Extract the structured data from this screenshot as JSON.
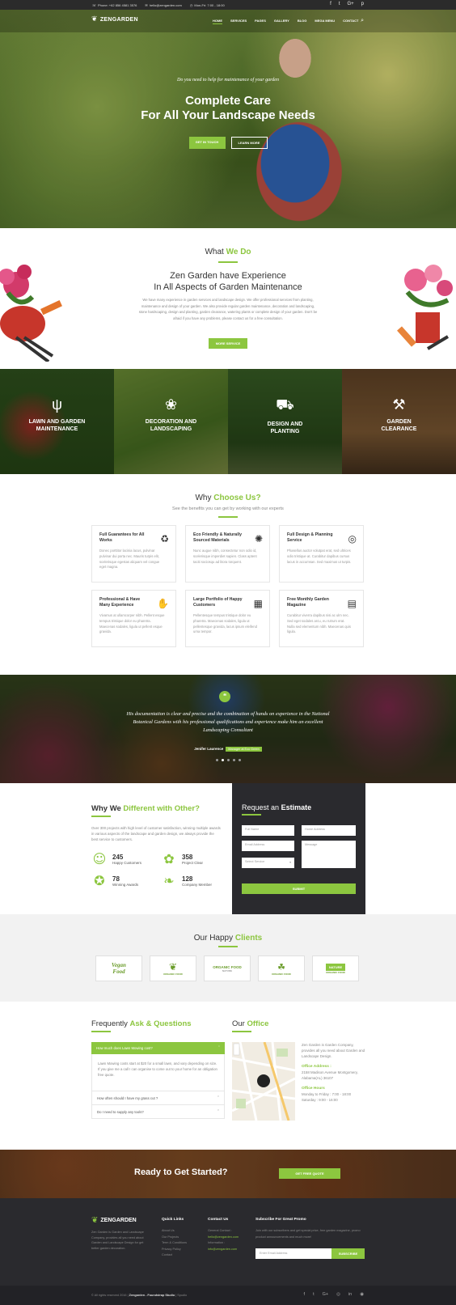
{
  "topbar": {
    "phone": "Phone: +62 856 4581 3576",
    "email": "hello@zengarden.com",
    "hours": "Mon-Fri: 7:00 - 18:00",
    "social": [
      "f",
      "t",
      "G+",
      "p"
    ]
  },
  "nav": {
    "logo": "ZENGARDEN",
    "items": [
      "HOME",
      "SERVICES",
      "PAGES",
      "GALLERY",
      "BLOG",
      "MEGA MENU",
      "CONTACT"
    ]
  },
  "hero": {
    "tagline": "Do you need to help for maintenance of your garden",
    "title_line1": "Complete Care",
    "title_line2": "For All Your Landscape Needs",
    "btn_primary": "GET IN TOUCH",
    "btn_secondary": "LEARN MORE"
  },
  "what_we_do": {
    "title_a": "What",
    "title_b": "We Do",
    "heading_line1": "Zen Garden have Experience",
    "heading_line2": "In All Aspects of Garden Maintenance",
    "text": "We have many experience in garden services and landscape design. We offer professional services from planting, maintenance and design of your garden. We also provide regular garden maintenance, decoration and landscaping, stone hardscaping, design and planting, garden clearance, watering plants or complete design of your garden. Don't be afraid if you have any problems, please contact us for a free consultation.",
    "button": "MORE SERVICE"
  },
  "services": [
    {
      "line1": "LAWN AND GARDEN",
      "line2": "MAINTENANCE",
      "icon": "grass-icon"
    },
    {
      "line1": "DECORATION AND",
      "line2": "LANDSCAPING",
      "icon": "sprout-icon"
    },
    {
      "line1": "DESIGN AND",
      "line2": "PLANTING",
      "icon": "wheelbarrow-icon"
    },
    {
      "line1": "GARDEN",
      "line2": "CLEARANCE",
      "icon": "tools-icon"
    }
  ],
  "why": {
    "title_a": "Why",
    "title_b": "Choose Us?",
    "subtitle": "See the benefits you can get by working with our experts",
    "cards": [
      {
        "title": "Full Guarantees for All Works",
        "text": "Donec porttitor lacinia lacus, pulvinar pulvinar dui porta nec. Mauris turpis elit, scelerisque egestas aliquam vel congue eget magna."
      },
      {
        "title": "Eco Friendly & Naturally Sourced Materials",
        "text": "Nunc augue nibh, consectetur non odio id, scelerisque imperdiet sapien. Class aptent taciti sociosqu ad litora torquent."
      },
      {
        "title": "Full Design & Planning Service",
        "text": "Phasellus auctor volutpat erat, sed ultrices odio tristique at. Curabitur dapibus cursus lacus in accumsan. Sed maximus ut turpis."
      },
      {
        "title": "Professional & Have Many Experience",
        "text": "Vivamus at ullamcorper nibh. Pellent esque tempus tristique dolor eu pharetra. Maecenas sodales, ligula ut pellent esque gravida."
      },
      {
        "title": "Large Portfolio of Happy Customers",
        "text": "Pellentesque tempus tristique dolor eu pharetra. Maecenas sodales, ligula ut pellentesque gravida, lacus ipsum eleifend urna tempor."
      },
      {
        "title": "Free Monthly Garden Magazine",
        "text": "Curabitur viverra dapibus nisi ac ulm nec. Sed eget sodales arcu, eu rutrum erat. Nulla sed elementum nibh. Maecenas quis ligula."
      }
    ]
  },
  "testimonial": {
    "quote": "His documentation is clear and precise and the combination of hands on experience in the National Botanical Gardens with his professional qualifications and experience make him an excellent Landscaping Consultant",
    "author": "Jenifer Laurence",
    "role": "Manager at Eco Green"
  },
  "different": {
    "title_a": "Why We",
    "title_b": "Different with Other?",
    "text": "Over 300 projects with high level of customer satisfaction, winning multiple awards in various aspects of the landscape and garden design, we always provide the best service to customers.",
    "stats": [
      {
        "value": "245",
        "label": "Happy Customers"
      },
      {
        "value": "358",
        "label": "Project Clear"
      },
      {
        "value": "78",
        "label": "Winning Awards"
      },
      {
        "value": "128",
        "label": "Company Member"
      }
    ]
  },
  "estimate": {
    "title_a": "Request an",
    "title_b": "Estimate",
    "full_name": "Full Name",
    "home_address": "Home Address",
    "email": "Email Address",
    "message": "Message",
    "select": "Select Service",
    "submit": "SUBMIT"
  },
  "clients": {
    "title_a": "Our Happy",
    "title_b": "Clients",
    "logos": [
      {
        "line1": "Vegan",
        "line2": "Food"
      },
      {
        "line1": "",
        "line2": "ORGANIC FOOD"
      },
      {
        "line1": "ORGANIC FOOD",
        "line2": "NATURE"
      },
      {
        "line1": "",
        "line2": "ORGANIC FOOD"
      },
      {
        "line1": "NATURE",
        "line2": "ORGANIC FOOD"
      }
    ]
  },
  "faq": {
    "title_a": "Frequently",
    "title_b": "Ask & Questions",
    "q1": "How much does Lawn Mowing cost?",
    "a1": "Lawn Mowing costs start at $20 for a small lawn, and vary depending on size. If you give me a call I can organise to come out to your home for an obligation free quote.",
    "q2": "How often should I have my grass cut ?",
    "q3": "Do I need to supply any tools?"
  },
  "office": {
    "title_a": "Our",
    "title_b": "Office",
    "intro": "Zen Garden is Garden Company, provides all you need about Garden and Landscape Design.",
    "address_label": "Office Address :",
    "address": "2158 Madison Avenue Montgomery, Alabama(AL) 36107",
    "hours_label": "Office Hours",
    "hours1": "Monday to Friday : 7:00 - 18:00",
    "hours2": "Saturday : 9:00 - 16:00"
  },
  "cta": {
    "text": "Ready to Get Started?",
    "button": "GET FREE QUOTE"
  },
  "footer": {
    "logo": "ZENGARDEN",
    "desc": "Zen Garden is Garden and Landscape Company, provides all you need about Garden and Landscape Design for get better garden decoration.",
    "quick_title": "Quick Links",
    "quick": [
      "About Us",
      "Our Projects",
      "Term & Conditions",
      "Privacy Policy",
      "Contact"
    ],
    "contact_title": "Contact Us",
    "general_label": "General Contact :",
    "general_email": "hello@zengarden.com",
    "info_label": "Information :",
    "info_email": "info@zengarden.com",
    "promo_title": "Subscribe For Great Promo",
    "promo_text": "Join with our subscribers and get special price, free garden magazine, promo product announcements and much more!",
    "email_placeholder": "Enter Email Address",
    "subscribe": "SUBSCRIBE",
    "copyright_a": "© All rights reserved 2016 |",
    "copyright_b": "Zengarden - Foundstrap Studio",
    "copyright_c": "| Spudio",
    "social": [
      "f",
      "t",
      "G+",
      "◎",
      "in",
      "◉"
    ]
  },
  "colors": {
    "accent": "#8cc63f",
    "dark": "#2a2a2e"
  }
}
